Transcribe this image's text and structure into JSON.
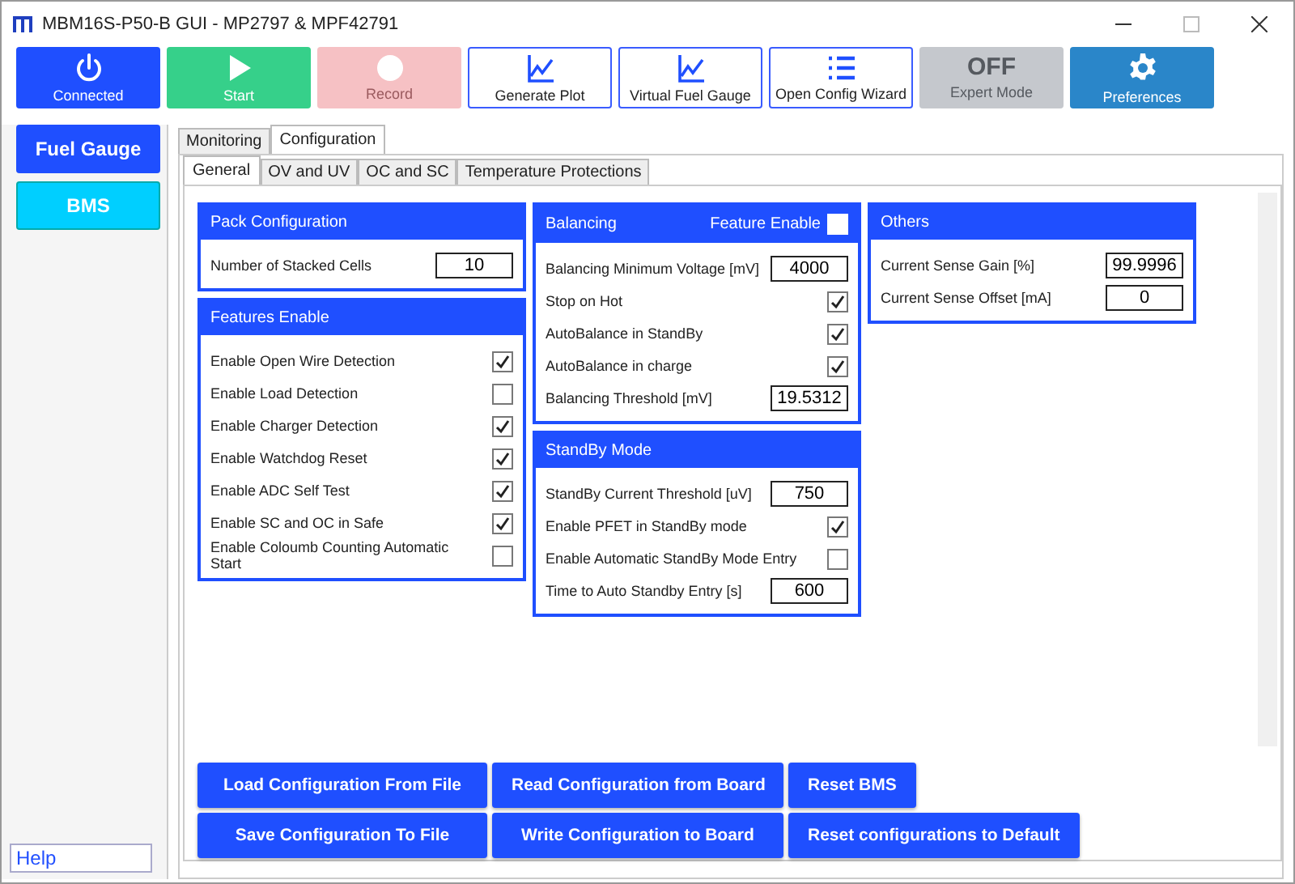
{
  "window": {
    "title": "MBM16S-P50-B GUI - MP2797 & MPF42791"
  },
  "toolbar": [
    {
      "label": "Connected",
      "kind": "blue"
    },
    {
      "label": "Start",
      "kind": "green"
    },
    {
      "label": "Record",
      "kind": "pink"
    },
    {
      "label": "Generate Plot",
      "kind": "outline"
    },
    {
      "label": "Virtual Fuel Gauge",
      "kind": "outline"
    },
    {
      "label": "Open Config Wizard",
      "kind": "outline"
    },
    {
      "label": "Expert Mode",
      "value": "OFF",
      "kind": "grey"
    },
    {
      "label": "Preferences",
      "kind": "steel"
    }
  ],
  "sidebar": {
    "items": [
      {
        "label": "Fuel Gauge",
        "selected": false
      },
      {
        "label": "BMS",
        "selected": true
      }
    ],
    "help": {
      "value": "Help"
    }
  },
  "tabs": [
    {
      "label": "Monitoring",
      "selected": false
    },
    {
      "label": "Configuration",
      "selected": true
    }
  ],
  "subtabs": [
    {
      "label": "General",
      "selected": true
    },
    {
      "label": "OV and UV",
      "selected": false
    },
    {
      "label": "OC and SC",
      "selected": false
    },
    {
      "label": "Temperature Protections",
      "selected": false
    }
  ],
  "columns": [
    [
      {
        "title": "Pack Configuration",
        "rows": [
          {
            "kind": "number",
            "label": "Number of Stacked Cells",
            "value": "10"
          }
        ]
      },
      {
        "title": "Features Enable",
        "rows": [
          {
            "kind": "checkbox",
            "label": "Enable Open Wire Detection",
            "checked": true
          },
          {
            "kind": "checkbox",
            "label": "Enable Load Detection",
            "checked": false
          },
          {
            "kind": "checkbox",
            "label": "Enable Charger Detection",
            "checked": true
          },
          {
            "kind": "checkbox",
            "label": "Enable Watchdog Reset",
            "checked": true
          },
          {
            "kind": "checkbox",
            "label": "Enable ADC Self Test",
            "checked": true
          },
          {
            "kind": "checkbox",
            "label": "Enable SC and OC in Safe",
            "checked": true
          },
          {
            "kind": "checkbox",
            "label": "Enable Coloumb Counting Automatic Start",
            "checked": false
          }
        ]
      }
    ],
    [
      {
        "title": "Balancing",
        "header_toggle": {
          "label": "Feature Enable",
          "checked": false
        },
        "rows": [
          {
            "kind": "number",
            "label": "Balancing Minimum Voltage [mV]",
            "value": "4000"
          },
          {
            "kind": "checkbox",
            "label": "Stop on Hot",
            "checked": true
          },
          {
            "kind": "checkbox",
            "label": "AutoBalance in StandBy",
            "checked": true
          },
          {
            "kind": "checkbox",
            "label": "AutoBalance in charge",
            "checked": true
          },
          {
            "kind": "number",
            "label": "Balancing Threshold [mV]",
            "value": "19.5312"
          }
        ]
      },
      {
        "title": "StandBy Mode",
        "rows": [
          {
            "kind": "number",
            "label": "StandBy Current Threshold [uV]",
            "value": "750"
          },
          {
            "kind": "checkbox",
            "label": "Enable PFET in StandBy mode",
            "checked": true
          },
          {
            "kind": "checkbox",
            "label": "Enable Automatic StandBy Mode Entry",
            "checked": false
          },
          {
            "kind": "number",
            "label": "Time to Auto Standby Entry [s]",
            "value": "600"
          }
        ]
      }
    ],
    [
      {
        "title": "Others",
        "rows": [
          {
            "kind": "number",
            "label": "Current Sense Gain [%]",
            "value": "99.9996"
          },
          {
            "kind": "number",
            "label": "Current Sense Offset [mA]",
            "value": "0"
          }
        ]
      }
    ]
  ],
  "actions": [
    [
      "Load Configuration From File",
      "Read Configuration from Board",
      "Reset BMS"
    ],
    [
      "Save Configuration To File",
      "Write Configuration to Board",
      "Reset configurations to Default"
    ]
  ]
}
